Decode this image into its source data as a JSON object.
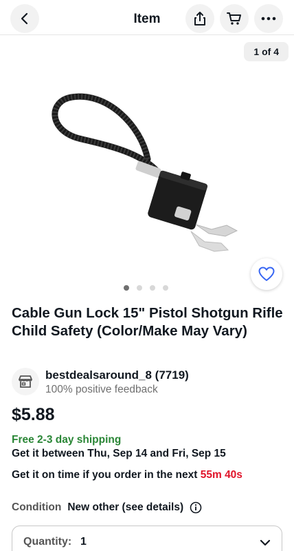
{
  "header": {
    "title": "Item",
    "icons": [
      "back-arrow-icon",
      "share-icon",
      "cart-icon",
      "more-icon"
    ]
  },
  "gallery": {
    "counter": "1 of 4",
    "total_images": 4,
    "active_index": 1
  },
  "product": {
    "title": "Cable Gun Lock 15\" Pistol Shotgun Rifle Child Safety (Color/Make May Vary)",
    "price": "$5.88"
  },
  "seller": {
    "name": "bestdealsaround_8 (7719)",
    "feedback": "100% positive feedback"
  },
  "shipping": {
    "free_label": "Free 2-3 day shipping",
    "delivery": "Get it between Thu, Sep 14 and Fri, Sep 15",
    "ontime_prefix": "Get it on time if you order in the next",
    "countdown": "55m 40s"
  },
  "condition": {
    "label": "Condition",
    "value": "New other (see details)"
  },
  "quantity": {
    "label": "Quantity:",
    "value": "1"
  },
  "colors": {
    "shipping_green": "#2a8636",
    "countdown_red": "#e0142a",
    "favorite_blue": "#3665f3"
  }
}
